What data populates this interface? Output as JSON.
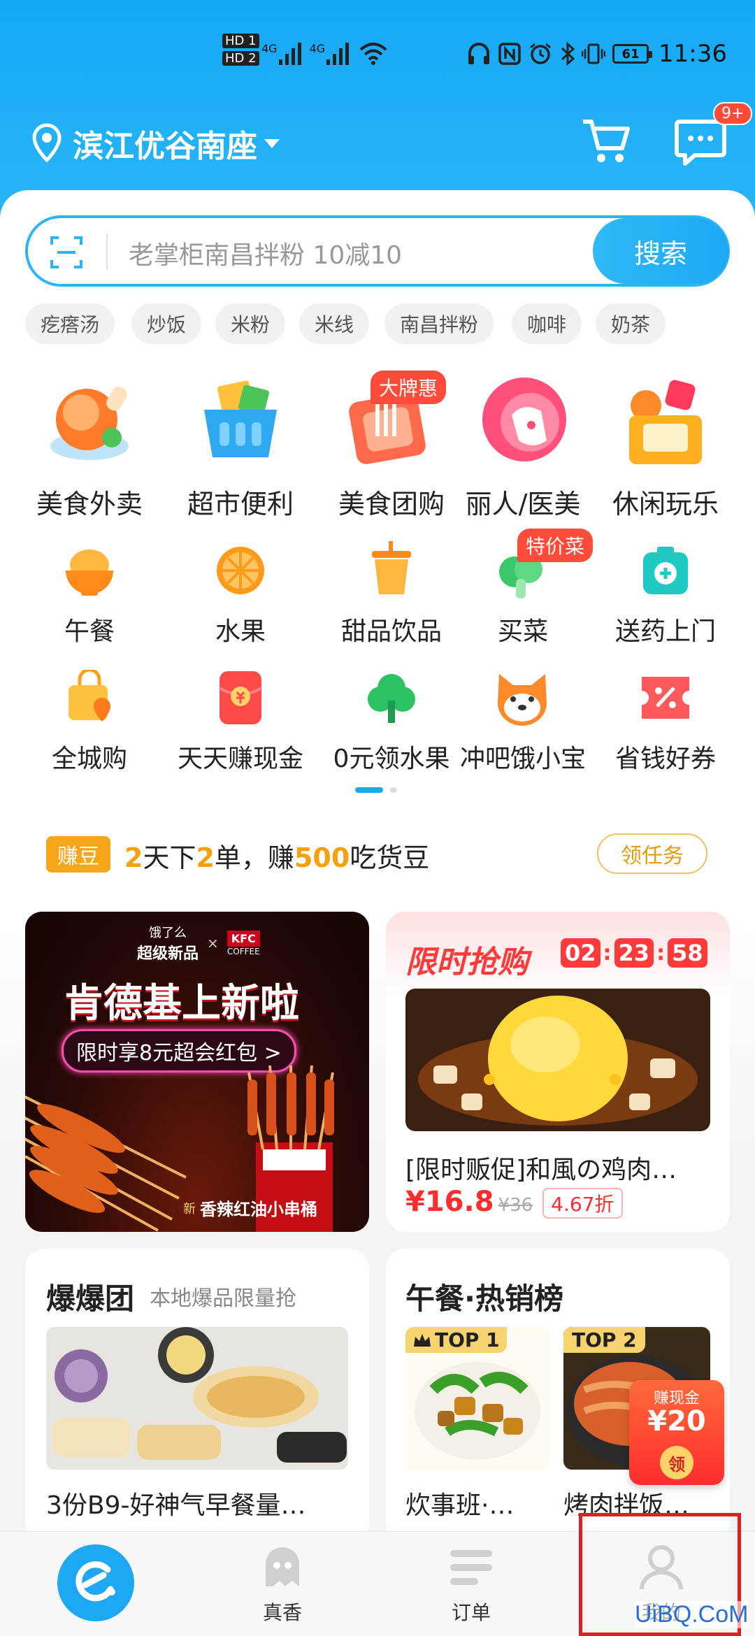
{
  "status_bar": {
    "hd1": "HD 1",
    "hd2": "HD 2",
    "net1": "4G",
    "net2": "4G",
    "battery": "61",
    "time": "11:36"
  },
  "header": {
    "location": "滨江优谷南座",
    "message_badge": "9+"
  },
  "search": {
    "placeholder": "老掌柜南昌拌粉 10减10",
    "button": "搜索"
  },
  "hot_tags": [
    "疙瘩汤",
    "炒饭",
    "米粉",
    "米线",
    "南昌拌粉",
    "咖啡",
    "奶茶"
  ],
  "big_categories": [
    {
      "label": "美食外卖"
    },
    {
      "label": "超市便利"
    },
    {
      "label": "美食团购",
      "badge": "大牌惠"
    },
    {
      "label": "丽人/医美"
    },
    {
      "label": "休闲玩乐"
    }
  ],
  "small_categories_row1": [
    {
      "label": "午餐"
    },
    {
      "label": "水果"
    },
    {
      "label": "甜品饮品"
    },
    {
      "label": "买菜",
      "badge": "特价菜"
    },
    {
      "label": "送药上门"
    }
  ],
  "small_categories_row2": [
    {
      "label": "全城购"
    },
    {
      "label": "天天赚现金"
    },
    {
      "label": "0元领水果"
    },
    {
      "label": "冲吧饿小宝"
    },
    {
      "label": "省钱好券"
    }
  ],
  "earn_bar": {
    "tag": "赚豆",
    "n1": "2",
    "t1": "天下",
    "n2": "2",
    "t2": "单，赚",
    "n3": "500",
    "t3": "吃货豆",
    "button": "领任务"
  },
  "kfc_banner": {
    "brand": "饿了么",
    "sub": "超级新品",
    "kfc": "KFC",
    "kfc_sub": "COFFEE",
    "title": "肯德基上新啦",
    "pill": "限时享8元超会红包 >",
    "product": "香辣红油小串桶",
    "new_tag": "新"
  },
  "flash_sale": {
    "title": "限时抢购",
    "hh": "02",
    "mm": "23",
    "ss": "58",
    "item": "[限时贩促]和風の鸡肉…",
    "price": "¥16.8",
    "orig": "¥36",
    "discount": "4.67折"
  },
  "baobao": {
    "title": "爆爆团",
    "sub": "本地爆品限量抢",
    "item": "3份B9-好神气早餐量…"
  },
  "lunch_rank": {
    "title": "午餐·热销榜",
    "top1": "TOP 1",
    "top2": "TOP 2",
    "item1": "炊事班·…",
    "item2": "烤肉拌饭…",
    "cash_tag": "赚现金",
    "cash_amount": "¥20",
    "cash_btn": "领"
  },
  "bottom_nav": {
    "tab2": "真香",
    "tab3": "订单",
    "tab4": "我的"
  },
  "watermark": "UiBQ.CoM",
  "colors": {
    "primary": "#1ea8f4",
    "highlight_box": "#e02020",
    "price": "#ff2d2d",
    "gold": "#f5a00f"
  }
}
